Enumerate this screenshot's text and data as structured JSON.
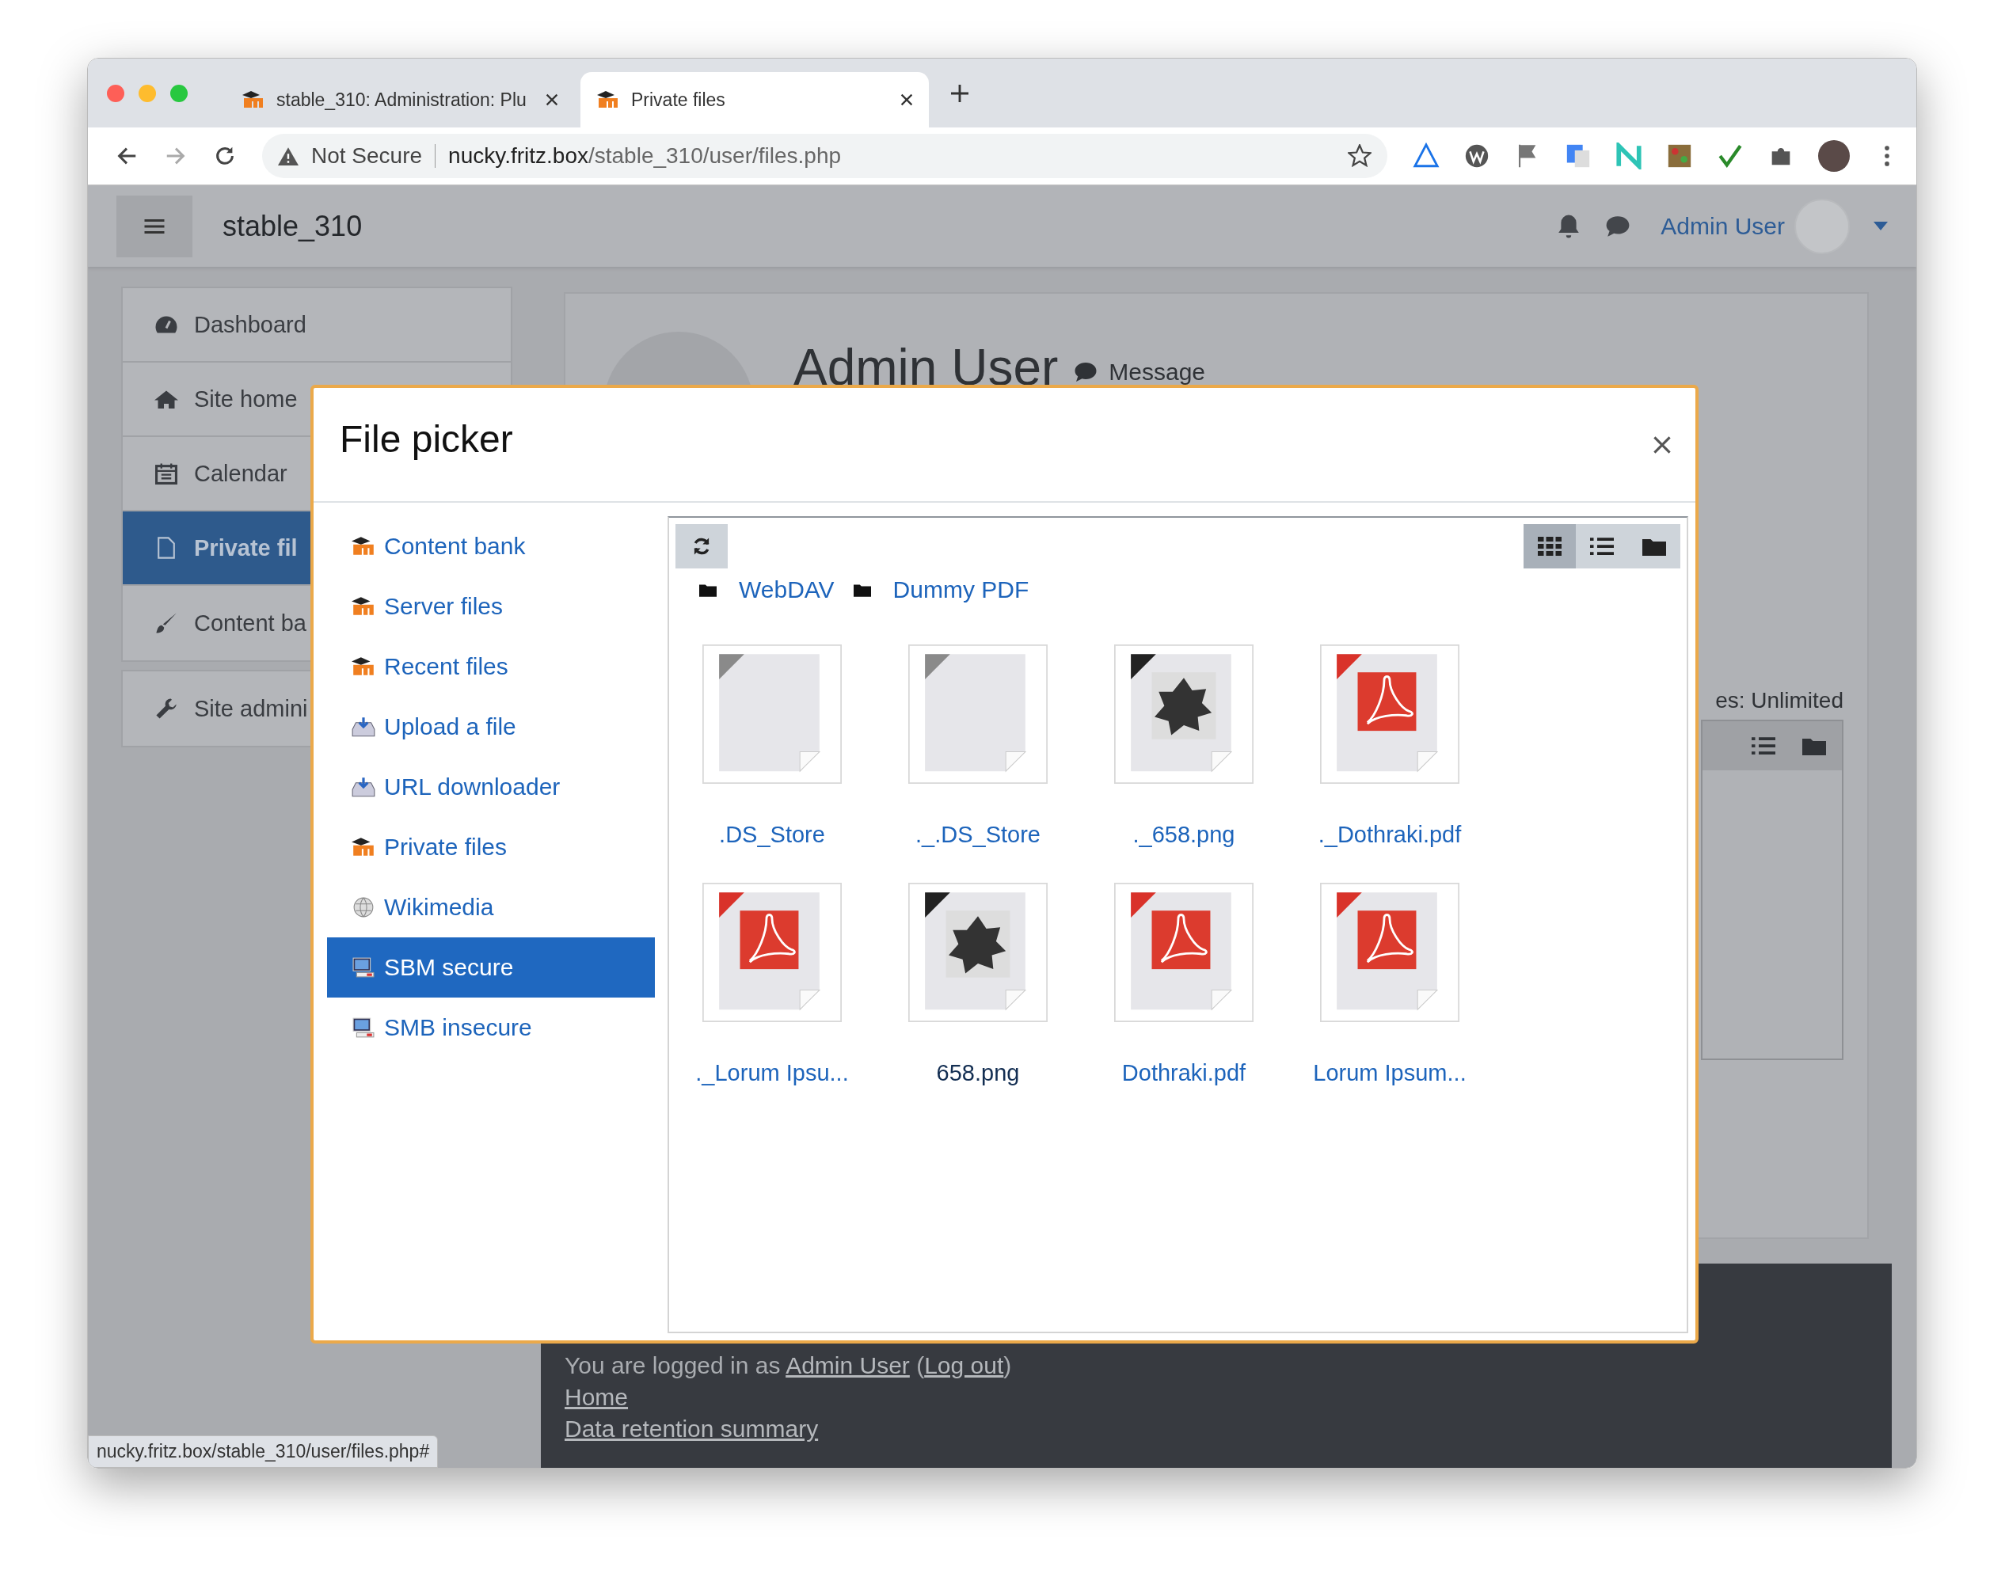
{
  "browser": {
    "tabs": [
      {
        "title": "stable_310: Administration: Plu",
        "selected": false
      },
      {
        "title": "Private files",
        "selected": true
      }
    ],
    "security_label": "Not Secure",
    "url_host": "nucky.fritz.box",
    "url_path": "/stable_310/user/files.php",
    "status_url": "nucky.fritz.box/stable_310/user/files.php#"
  },
  "navbar": {
    "site_name": "stable_310",
    "user_name": "Admin User"
  },
  "sidebar": {
    "groups": [
      [
        {
          "label": "Dashboard",
          "kind": "dashboard",
          "selected": false
        },
        {
          "label": "Site home",
          "kind": "home",
          "selected": false
        },
        {
          "label": "Calendar",
          "kind": "calendar",
          "selected": false
        },
        {
          "label": "Private fil",
          "kind": "file",
          "selected": true
        },
        {
          "label": "Content ba",
          "kind": "brush",
          "selected": false
        }
      ],
      [
        {
          "label": "Site admini",
          "kind": "wrench",
          "selected": false
        }
      ]
    ]
  },
  "profile": {
    "name": "Admin User",
    "message": "Message",
    "quota": "es: Unlimited"
  },
  "footer": {
    "segments": [
      {
        "text": "You are logged in as ",
        "link": false
      },
      {
        "text": "Admin User",
        "link": true
      },
      {
        "text": " (",
        "link": false
      },
      {
        "text": "Log out",
        "link": true
      },
      {
        "text": ")",
        "link": false
      }
    ],
    "links": [
      "Home",
      "Data retention summary"
    ]
  },
  "modal": {
    "title": "File picker",
    "repositories": [
      {
        "label": "Content bank",
        "kind": "moodle",
        "selected": false
      },
      {
        "label": "Server files",
        "kind": "moodle",
        "selected": false
      },
      {
        "label": "Recent files",
        "kind": "moodle",
        "selected": false
      },
      {
        "label": "Upload a file",
        "kind": "upload",
        "selected": false
      },
      {
        "label": "URL downloader",
        "kind": "upload",
        "selected": false
      },
      {
        "label": "Private files",
        "kind": "moodle",
        "selected": false
      },
      {
        "label": "Wikimedia",
        "kind": "globe",
        "selected": false
      },
      {
        "label": "SBM secure",
        "kind": "computer",
        "selected": true
      },
      {
        "label": "SMB insecure",
        "kind": "computer",
        "selected": false
      }
    ],
    "breadcrumb": [
      "WebDAV",
      "Dummy PDF"
    ],
    "views": [
      {
        "kind": "icons",
        "selected": true
      },
      {
        "kind": "list",
        "selected": false
      },
      {
        "kind": "tree",
        "selected": false
      }
    ],
    "files": [
      {
        "name": ".DS_Store",
        "kind": "generic",
        "selected": false
      },
      {
        "name": "._.DS_Store",
        "kind": "generic",
        "selected": false
      },
      {
        "name": "._658.png",
        "kind": "image",
        "selected": false
      },
      {
        "name": "._Dothraki.pdf",
        "kind": "pdf",
        "selected": false
      },
      {
        "name": "._Lorum Ipsu...",
        "kind": "pdf",
        "selected": false
      },
      {
        "name": "658.png",
        "kind": "image",
        "selected": true
      },
      {
        "name": "Dothraki.pdf",
        "kind": "pdf",
        "selected": false
      },
      {
        "name": "Lorum Ipsum...",
        "kind": "pdf",
        "selected": false
      }
    ]
  }
}
